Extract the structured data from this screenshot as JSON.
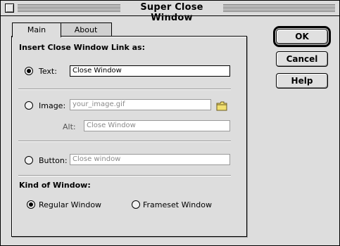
{
  "window": {
    "title": "Super Close Window"
  },
  "tabs": [
    {
      "label": "Main",
      "active": true
    },
    {
      "label": "About",
      "active": false
    }
  ],
  "main": {
    "heading": "Insert Close Window Link as:",
    "options": [
      {
        "label": "Text:",
        "selected": true,
        "value": "Close Window"
      },
      {
        "label": "Image:",
        "selected": false,
        "value": "your_image.gif"
      },
      {
        "label": "Button:",
        "selected": false,
        "value": "Close window"
      }
    ],
    "alt": {
      "label": "Alt:",
      "value": "Close Window"
    },
    "kind_heading": "Kind of Window:",
    "kinds": [
      {
        "label": "Regular Window",
        "selected": true
      },
      {
        "label": "Frameset Window",
        "selected": false
      }
    ]
  },
  "buttons": {
    "ok": "OK",
    "cancel": "Cancel",
    "help": "Help"
  },
  "icons": {
    "close": "close-box-icon",
    "folder": "folder-icon"
  },
  "colors": {
    "window_bg": "#dddddd",
    "folder": "#f2e070"
  }
}
